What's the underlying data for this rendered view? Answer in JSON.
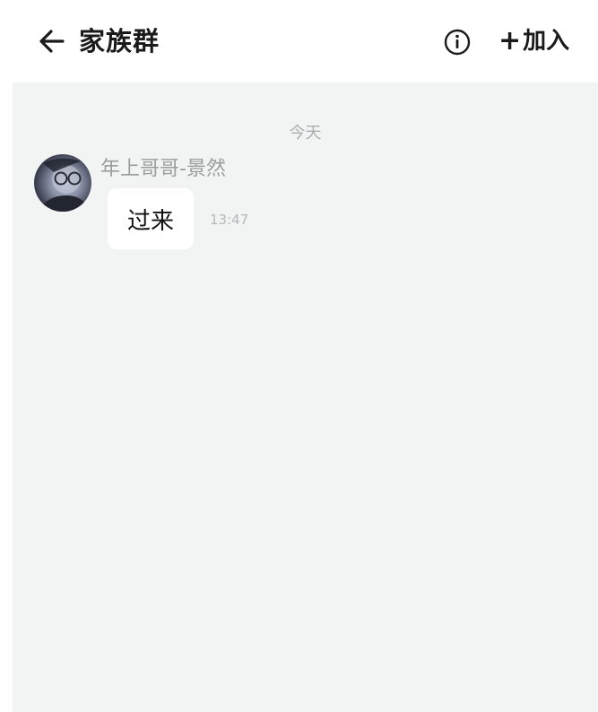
{
  "header": {
    "title": "家族群",
    "join_label": "加入",
    "join_plus": "+"
  },
  "chat": {
    "date_divider": "今天",
    "messages": [
      {
        "sender": "年上哥哥-景然",
        "text": "过来",
        "time": "13:47"
      }
    ]
  },
  "icons": {
    "back": "back-arrow-icon",
    "info": "info-icon"
  },
  "colors": {
    "header_bg": "#ffffff",
    "chat_bg": "#f2f4f4",
    "bubble_bg": "#ffffff",
    "muted_text": "#9a9d9d"
  }
}
